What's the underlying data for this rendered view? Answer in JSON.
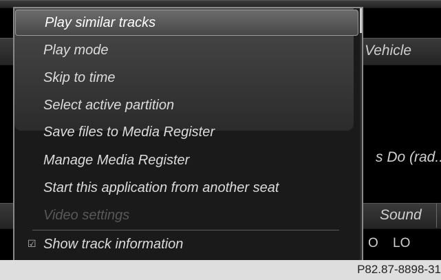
{
  "background": {
    "vehicle_label": "Vehicle",
    "station_label": "s Do (rad...",
    "sound_label": "Sound",
    "level_left": "O",
    "level_right": "LO"
  },
  "menu": {
    "items": [
      {
        "label": "Play similar tracks"
      },
      {
        "label": "Play mode"
      },
      {
        "label": "Skip to time"
      },
      {
        "label": "Select active partition"
      },
      {
        "label": "Save files to Media Register"
      },
      {
        "label": "Manage Media Register"
      },
      {
        "label": "Start this application from another seat"
      },
      {
        "label": "Video settings"
      },
      {
        "label": "Show track information"
      }
    ],
    "checkbox_glyph": "☑"
  },
  "caption": {
    "code": "P82.87-8898-31"
  }
}
